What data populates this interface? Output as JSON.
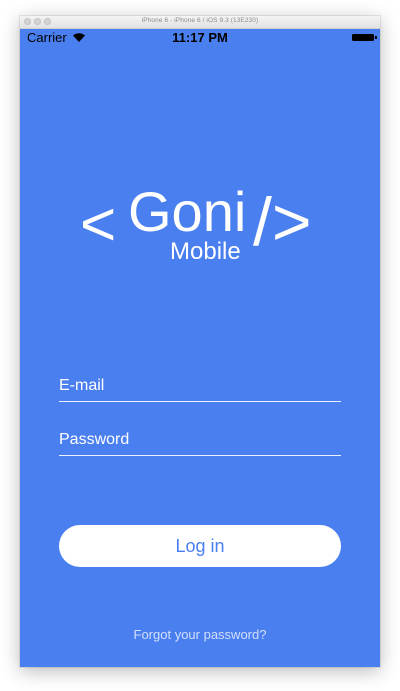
{
  "window": {
    "title": "iPhone 6 - iPhone 6 / iOS 9.3 (13E230)"
  },
  "status_bar": {
    "carrier": "Carrier",
    "time": "11:17 PM",
    "wifi_icon": "wifi-icon",
    "battery_icon": "battery-icon"
  },
  "logo": {
    "open_bracket": "<",
    "name": "Goni",
    "subtitle": "Mobile",
    "close_bracket": "/>"
  },
  "form": {
    "email_placeholder": "E-mail",
    "email_value": "",
    "password_placeholder": "Password",
    "password_value": "",
    "login_label": "Log in",
    "forgot_label": "Forgot your password?"
  },
  "colors": {
    "background": "#4a7ff0",
    "button_background": "#ffffff",
    "button_text": "#4a7ff0",
    "text": "#ffffff"
  }
}
